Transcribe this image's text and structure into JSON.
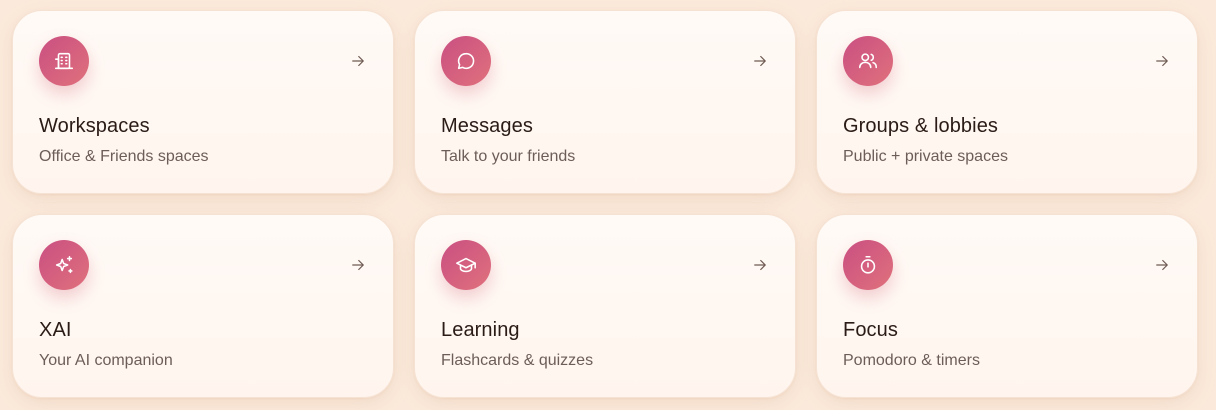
{
  "cards": [
    {
      "title": "Workspaces",
      "subtitle": "Office & Friends spaces",
      "icon": "building-icon",
      "arrow_icon": "arrow-right-icon"
    },
    {
      "title": "Messages",
      "subtitle": "Talk to your friends",
      "icon": "chat-bubble-icon",
      "arrow_icon": "arrow-right-icon"
    },
    {
      "title": "Groups & lobbies",
      "subtitle": "Public + private spaces",
      "icon": "users-icon",
      "arrow_icon": "arrow-right-icon"
    },
    {
      "title": "XAI",
      "subtitle": "Your AI companion",
      "icon": "sparkles-icon",
      "arrow_icon": "arrow-right-icon"
    },
    {
      "title": "Learning",
      "subtitle": "Flashcards & quizzes",
      "icon": "graduation-cap-icon",
      "arrow_icon": "arrow-right-icon"
    },
    {
      "title": "Focus",
      "subtitle": "Pomodoro & timers",
      "icon": "stopwatch-icon",
      "arrow_icon": "arrow-right-icon"
    }
  ],
  "colors": {
    "background": "#fbeadb",
    "card": "#fffaf6",
    "accent_start": "#c94f82",
    "accent_end": "#e0717c",
    "title": "#2a1b16",
    "subtitle": "#6d5d58"
  }
}
